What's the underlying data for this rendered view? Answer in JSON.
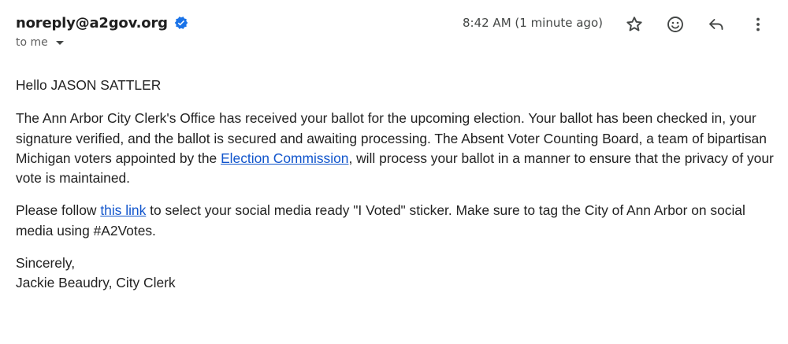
{
  "header": {
    "sender": "noreply@a2gov.org",
    "recipient_label": "to me",
    "timestamp": "8:42 AM (1 minute ago)"
  },
  "icons": {
    "verified": "verified-badge-icon",
    "star": "star-icon",
    "emoji": "emoji-icon",
    "reply": "reply-icon",
    "more": "more-vert-icon"
  },
  "colors": {
    "link": "#1155cc",
    "verified": "#1a73e8"
  },
  "body": {
    "greeting": "Hello JASON SATTLER",
    "p1_before_link": "The Ann Arbor City Clerk's Office has received your ballot for the upcoming election. Your ballot has been checked in, your signature verified, and the ballot is secured and awaiting processing. The Absent Voter Counting Board, a team of bipartisan Michigan voters appointed by the ",
    "p1_link": "Election Commission",
    "p1_after_link": ", will process your ballot in a manner to ensure that the privacy of your vote is maintained.",
    "p2_before_link": "Please follow ",
    "p2_link": "this link",
    "p2_after_link": " to select your social media ready \"I Voted\" sticker. Make sure to tag the City of Ann Arbor on social media using #A2Votes.",
    "closing": "Sincerely,",
    "signature": "Jackie Beaudry, City Clerk"
  }
}
